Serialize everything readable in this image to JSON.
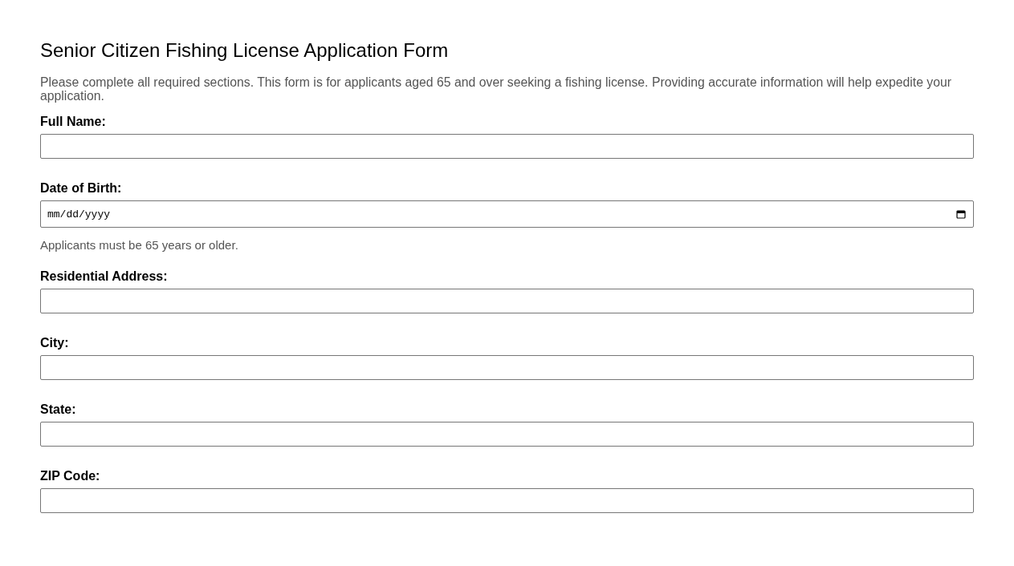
{
  "title": "Senior Citizen Fishing License Application Form",
  "intro": "Please complete all required sections. This form is for applicants aged 65 and over seeking a fishing license. Providing accurate information will help expedite your application.",
  "fields": [
    {
      "kind": "text",
      "label": "Full Name:"
    },
    {
      "kind": "date",
      "label": "Date of Birth:",
      "placeholder": "mm/dd/yyyy",
      "hint": "Applicants must be 65 years or older."
    },
    {
      "kind": "text",
      "label": "Residential Address:"
    },
    {
      "kind": "text",
      "label": "City:"
    },
    {
      "kind": "text",
      "label": "State:"
    },
    {
      "kind": "text",
      "label": "ZIP Code:"
    }
  ]
}
